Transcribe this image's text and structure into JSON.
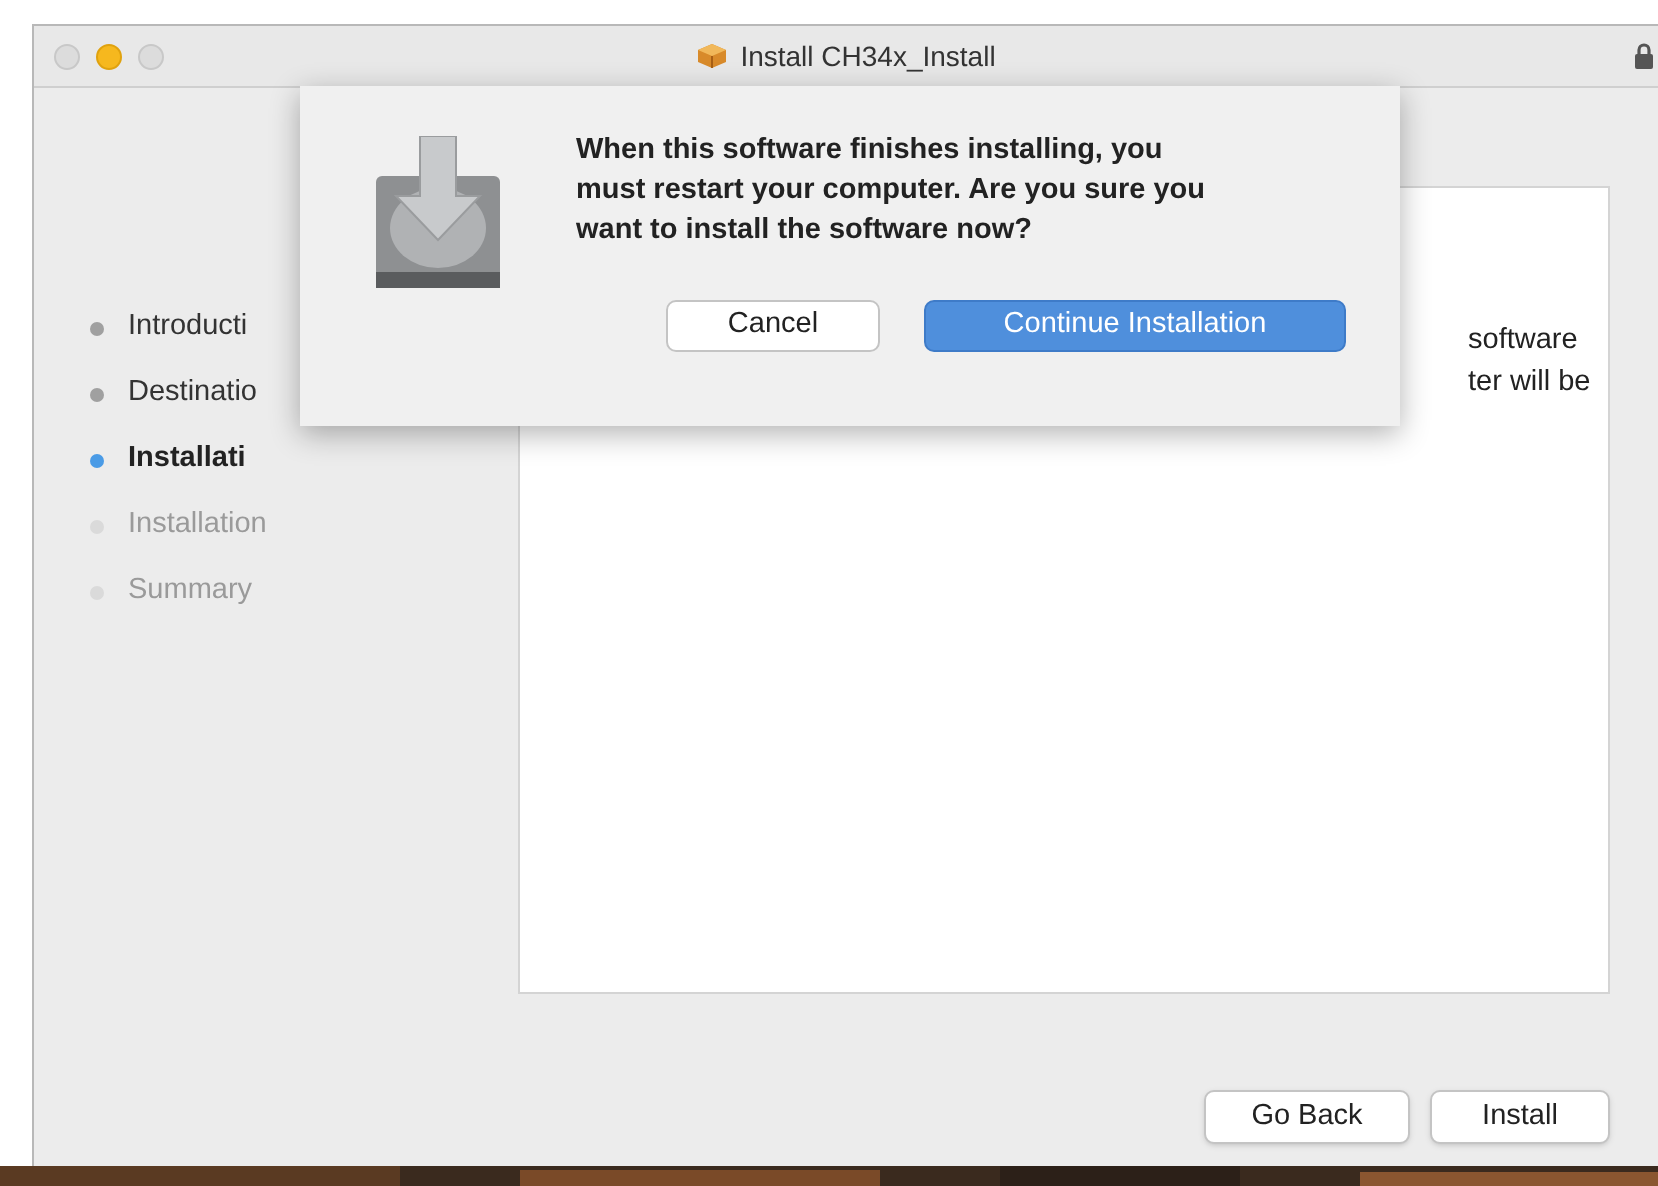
{
  "window": {
    "title": "Install CH34x_Install"
  },
  "sidebar": {
    "items": [
      {
        "label": "Introducti",
        "completed": true,
        "selected": false
      },
      {
        "label": "Destinatio",
        "completed": true,
        "selected": false
      },
      {
        "label": "Installati",
        "completed": false,
        "selected": true
      },
      {
        "label": "Installation",
        "completed": false,
        "selected": false
      },
      {
        "label": "Summary",
        "completed": false,
        "selected": false
      }
    ]
  },
  "content": {
    "lines": [
      "software",
      "ter will be"
    ]
  },
  "buttons": [
    {
      "label": "Go Back"
    },
    {
      "label": "Install"
    }
  ],
  "dialog": {
    "message": "When this software finishes installing, you must restart your computer. Are you sure you want to install the software now?",
    "buttons": [
      {
        "label": "Cancel",
        "default": false
      },
      {
        "label": "Continue Installation",
        "default": true
      }
    ]
  }
}
